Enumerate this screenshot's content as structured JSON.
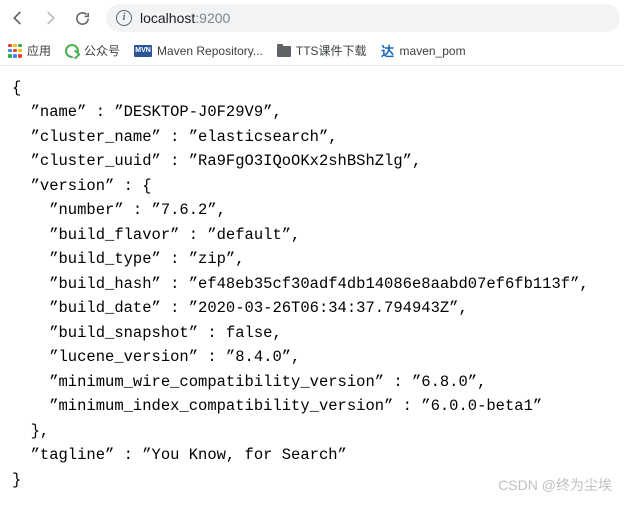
{
  "nav": {
    "url_host": "localhost",
    "url_port": ":9200"
  },
  "bookmarks": {
    "apps": "应用",
    "gzh": "公众号",
    "mvn": "Maven Repository...",
    "mvn_icon": "MVN",
    "tts": "TTS课件下载",
    "da": "达",
    "pom": "maven_pom"
  },
  "json": {
    "name": "DESKTOP-J0F29V9",
    "cluster_name": "elasticsearch",
    "cluster_uuid": "Ra9FgO3IQoOKx2shBShZlg",
    "version": {
      "number": "7.6.2",
      "build_flavor": "default",
      "build_type": "zip",
      "build_hash": "ef48eb35cf30adf4db14086e8aabd07ef6fb113f",
      "build_date": "2020-03-26T06:34:37.794943Z",
      "build_snapshot": "false",
      "lucene_version": "8.4.0",
      "minimum_wire_compatibility_version": "6.8.0",
      "minimum_index_compatibility_version": "6.0.0-beta1"
    },
    "tagline": "You Know, for Search"
  },
  "watermark": "CSDN @终为尘埃"
}
